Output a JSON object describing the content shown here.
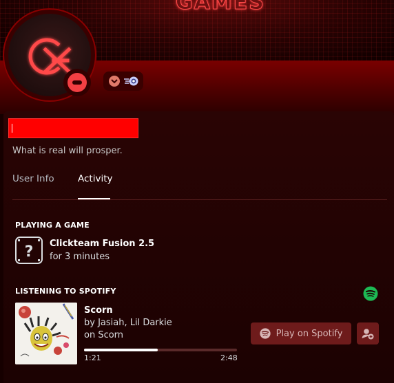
{
  "banner": {
    "text": "GAMES"
  },
  "profile": {
    "bio": "What is real will prosper.",
    "status": "do-not-disturb",
    "avatar_icon": "cg-logo-icon"
  },
  "tabs": [
    {
      "label": "User Info",
      "active": false
    },
    {
      "label": "Activity",
      "active": true
    }
  ],
  "game_section": {
    "title": "PLAYING A GAME",
    "game_name": "Clickteam Fusion 2.5",
    "duration": "for 3 minutes",
    "icon": "question-mark-icon"
  },
  "spotify_section": {
    "title": "LISTENING TO SPOTIFY",
    "track_title": "Scorn",
    "artist_line": "by Jasiah, Lil Darkie",
    "album_line": "on Scorn",
    "elapsed": "1:21",
    "total": "2:48",
    "progress_fraction": 0.48,
    "play_button_label": "Play on Spotify"
  },
  "colors": {
    "accent_red": "#ff0000",
    "dnd": "#f23f43",
    "spotify_green": "#1db954",
    "button_bg": "#6e1b1b"
  }
}
